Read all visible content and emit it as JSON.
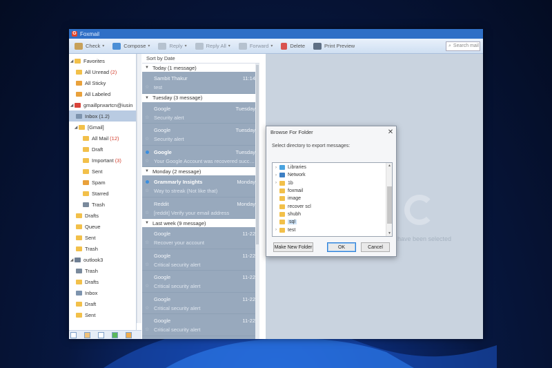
{
  "window": {
    "title": "Foxmail"
  },
  "toolbar": {
    "check": "Check",
    "compose": "Compose",
    "reply": "Reply",
    "reply_all": "Reply All",
    "forward": "Forward",
    "delete": "Delete",
    "print_preview": "Print Preview",
    "search_placeholder": "Search mail"
  },
  "sidebar": {
    "favorites": "Favorites",
    "all_unread": "All Unread",
    "all_unread_count": "(2)",
    "all_sticky": "All Sticky",
    "all_labeled": "All Labeled",
    "account1": "gmaillpnxartcn@iusin",
    "inbox": "Inbox",
    "inbox_count": "(1.2)",
    "gmail": "[Gmail]",
    "all_mail": "All Mail",
    "all_mail_count": "(12)",
    "draft": "Draft",
    "important": "Important",
    "important_count": "(3)",
    "sent": "Sent",
    "spam": "Spam",
    "starred": "Starred",
    "trash": "Trash",
    "drafts": "Drafts",
    "queue": "Queue",
    "sent2": "Sent",
    "trash2": "Trash",
    "account2": "outlook3",
    "a2_trash": "Trash",
    "a2_drafts": "Drafts",
    "a2_inbox": "Inbox",
    "a2_draft": "Draft",
    "a2_sent": "Sent"
  },
  "list": {
    "sort_label": "Sort by Date",
    "groups": {
      "today": "Today (1 message)",
      "tuesday": "Tuesday (3 message)",
      "monday": "Monday (2 message)",
      "last_week": "Last week (9 message)"
    },
    "messages": [
      {
        "sender": "Sambit Thakur",
        "time": "11:14",
        "subject": "test"
      },
      {
        "sender": "Google",
        "time": "Tuesday",
        "subject": "Security alert"
      },
      {
        "sender": "Google",
        "time": "Tuesday",
        "subject": "Security alert"
      },
      {
        "sender": "Google",
        "time": "Tuesday",
        "subject": "Your Google Account was recovered successfully"
      },
      {
        "sender": "Grammarly Insights",
        "time": "Monday",
        "subject": "Way to streak (Not like that)"
      },
      {
        "sender": "Reddit",
        "time": "Monday",
        "subject": "[reddit] Verify your email address"
      },
      {
        "sender": "Google",
        "time": "11-22",
        "subject": "Recover your account"
      },
      {
        "sender": "Google",
        "time": "11-22",
        "subject": "Critical security alert"
      },
      {
        "sender": "Google",
        "time": "11-22",
        "subject": "Critical security alert"
      },
      {
        "sender": "Google",
        "time": "11-22",
        "subject": "Critical security alert"
      },
      {
        "sender": "Google",
        "time": "11-22",
        "subject": "Critical security alert"
      }
    ]
  },
  "preview": {
    "empty_text": "ails have been selected"
  },
  "dialog": {
    "title": "Browse For Folder",
    "message": "Select directory to export messages:",
    "items": [
      "Libraries",
      "Network",
      "1b",
      "foxmail",
      "image",
      "recover scl",
      "shubh",
      "sql",
      "test"
    ],
    "make_folder": "Make New Folder",
    "ok": "OK",
    "cancel": "Cancel"
  }
}
